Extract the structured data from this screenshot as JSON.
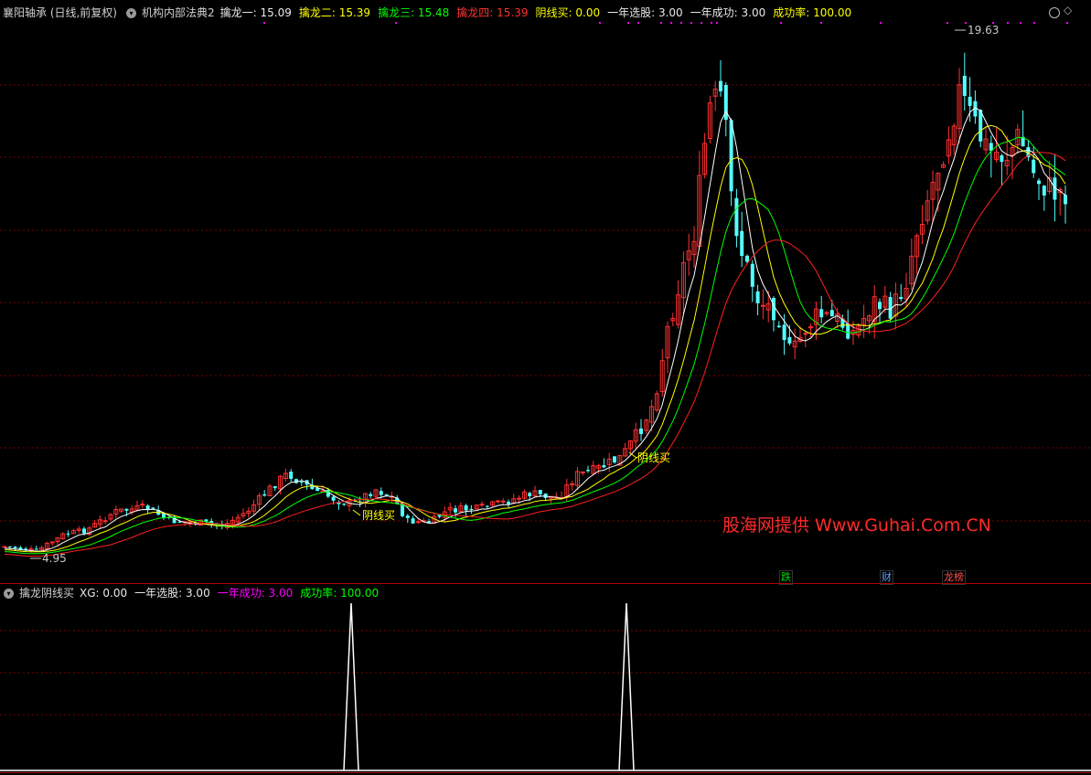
{
  "main_header": {
    "stock_label": "襄阳轴承 (日线,前复权)",
    "indicator_name": "机构内部法典2",
    "items": [
      {
        "label": "擒龙一: 15.09",
        "color": "#e8e8e8"
      },
      {
        "label": "擒龙二: 15.39",
        "color": "#ffff00"
      },
      {
        "label": "擒龙三: 15.48",
        "color": "#00ff00"
      },
      {
        "label": "擒龙四: 15.39",
        "color": "#ff3030"
      },
      {
        "label": "阴线买: 0.00",
        "color": "#ffff00"
      },
      {
        "label": "一年选股: 3.00",
        "color": "#e8e8e8"
      },
      {
        "label": "一年成功: 3.00",
        "color": "#e8e8e8"
      },
      {
        "label": "成功率: 100.00",
        "color": "#ffff00"
      }
    ]
  },
  "sub_header": {
    "indicator_name": "擒龙阴线买",
    "items": [
      {
        "label": "XG: 0.00",
        "color": "#e8e8e8"
      },
      {
        "label": "一年选股: 3.00",
        "color": "#e8e8e8"
      },
      {
        "label": "一年成功: 3.00",
        "color": "#ff00ff"
      },
      {
        "label": "成功率: 100.00",
        "color": "#00ff00"
      }
    ]
  },
  "price_high_label": "19.63",
  "price_low_label": "4.95",
  "signal_label": "阴线买",
  "watermark": "股海网提供 Www.Guhai.Com.CN",
  "event_markers": [
    {
      "text": "跌",
      "color": "#00e000"
    },
    {
      "text": "财",
      "color": "#5aa0ff"
    },
    {
      "text": "龙榜",
      "color": "#ff5050"
    }
  ],
  "icons": {
    "toggle": "settings-circle-icon",
    "top_right": [
      "circle-icon",
      "diamond-icon"
    ]
  },
  "colors": {
    "up": "#ff3030",
    "down": "#54ffff",
    "ma1": "#ffffff",
    "ma2": "#ffff00",
    "ma3": "#00ff00",
    "ma4": "#ff2020",
    "grid": "#7a0000"
  },
  "chart_data": [
    {
      "type": "candlestick",
      "title": "襄阳轴承 (日线,前复权)",
      "series": [
        {
          "name": "擒龙一",
          "last": 15.09
        },
        {
          "name": "擒龙二",
          "last": 15.39
        },
        {
          "name": "擒龙三",
          "last": 15.48
        },
        {
          "name": "擒龙四",
          "last": 15.39
        }
      ],
      "y_range_visible": [
        4.95,
        19.63
      ],
      "annotations": [
        "19.63",
        "4.95",
        "阴线买",
        "阴线买"
      ]
    },
    {
      "type": "line",
      "title": "擒龙阴线买",
      "series": [
        {
          "name": "XG",
          "x": [
            384,
            685
          ],
          "values": [
            1,
            1
          ]
        }
      ],
      "ylim": [
        0,
        1
      ]
    }
  ]
}
